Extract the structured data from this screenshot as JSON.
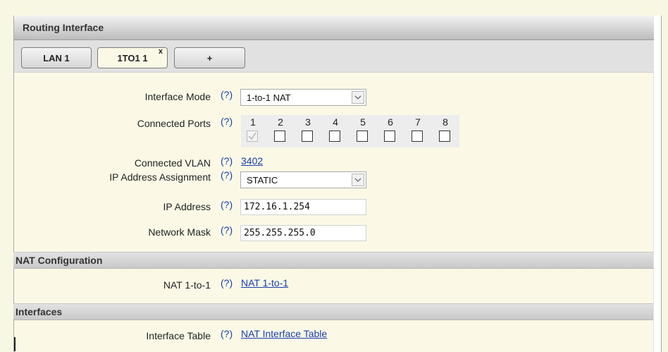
{
  "panel": {
    "title": "Routing Interface"
  },
  "tabs": [
    {
      "label": "LAN 1"
    },
    {
      "label": "1TO1 1",
      "close": "x"
    },
    {
      "label": "+"
    }
  ],
  "help_text": "(?)",
  "form": {
    "interface_mode": {
      "label": "Interface Mode",
      "value": "1-to-1 NAT"
    },
    "connected_ports": {
      "label": "Connected Ports",
      "ports": [
        {
          "number": "1",
          "checked": true
        },
        {
          "number": "2",
          "checked": false
        },
        {
          "number": "3",
          "checked": false
        },
        {
          "number": "4",
          "checked": false
        },
        {
          "number": "5",
          "checked": false
        },
        {
          "number": "6",
          "checked": false
        },
        {
          "number": "7",
          "checked": false
        },
        {
          "number": "8",
          "checked": false
        }
      ]
    },
    "connected_vlan": {
      "label": "Connected VLAN",
      "value": "3402"
    },
    "ip_assignment": {
      "label": "IP Address Assignment",
      "value": "STATIC"
    },
    "ip_address": {
      "label": "IP Address",
      "value": "172.16.1.254"
    },
    "network_mask": {
      "label": "Network Mask",
      "value": "255.255.255.0"
    }
  },
  "nat_section": {
    "title": "NAT Configuration",
    "label": "NAT 1-to-1",
    "link": "NAT 1-to-1"
  },
  "interfaces_section": {
    "title": "Interfaces",
    "label": "Interface Table",
    "link": "NAT Interface Table"
  },
  "colors": {
    "link": "#1a3fb0",
    "background": "#fbf9e6",
    "header": "#bdbdbd"
  }
}
